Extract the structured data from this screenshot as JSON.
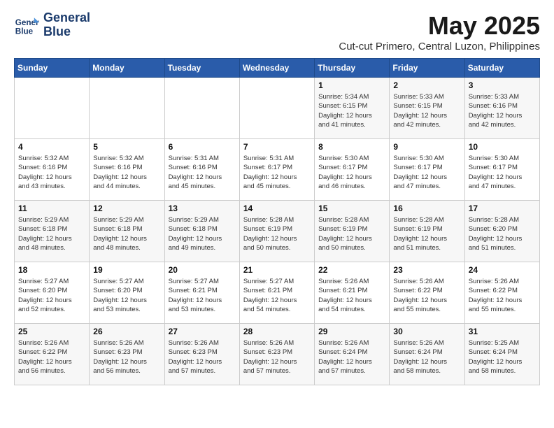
{
  "logo": {
    "line1": "General",
    "line2": "Blue"
  },
  "title": "May 2025",
  "subtitle": "Cut-cut Primero, Central Luzon, Philippines",
  "weekdays": [
    "Sunday",
    "Monday",
    "Tuesday",
    "Wednesday",
    "Thursday",
    "Friday",
    "Saturday"
  ],
  "weeks": [
    [
      {
        "day": "",
        "info": ""
      },
      {
        "day": "",
        "info": ""
      },
      {
        "day": "",
        "info": ""
      },
      {
        "day": "",
        "info": ""
      },
      {
        "day": "1",
        "info": "Sunrise: 5:34 AM\nSunset: 6:15 PM\nDaylight: 12 hours\nand 41 minutes."
      },
      {
        "day": "2",
        "info": "Sunrise: 5:33 AM\nSunset: 6:15 PM\nDaylight: 12 hours\nand 42 minutes."
      },
      {
        "day": "3",
        "info": "Sunrise: 5:33 AM\nSunset: 6:16 PM\nDaylight: 12 hours\nand 42 minutes."
      }
    ],
    [
      {
        "day": "4",
        "info": "Sunrise: 5:32 AM\nSunset: 6:16 PM\nDaylight: 12 hours\nand 43 minutes."
      },
      {
        "day": "5",
        "info": "Sunrise: 5:32 AM\nSunset: 6:16 PM\nDaylight: 12 hours\nand 44 minutes."
      },
      {
        "day": "6",
        "info": "Sunrise: 5:31 AM\nSunset: 6:16 PM\nDaylight: 12 hours\nand 45 minutes."
      },
      {
        "day": "7",
        "info": "Sunrise: 5:31 AM\nSunset: 6:17 PM\nDaylight: 12 hours\nand 45 minutes."
      },
      {
        "day": "8",
        "info": "Sunrise: 5:30 AM\nSunset: 6:17 PM\nDaylight: 12 hours\nand 46 minutes."
      },
      {
        "day": "9",
        "info": "Sunrise: 5:30 AM\nSunset: 6:17 PM\nDaylight: 12 hours\nand 47 minutes."
      },
      {
        "day": "10",
        "info": "Sunrise: 5:30 AM\nSunset: 6:17 PM\nDaylight: 12 hours\nand 47 minutes."
      }
    ],
    [
      {
        "day": "11",
        "info": "Sunrise: 5:29 AM\nSunset: 6:18 PM\nDaylight: 12 hours\nand 48 minutes."
      },
      {
        "day": "12",
        "info": "Sunrise: 5:29 AM\nSunset: 6:18 PM\nDaylight: 12 hours\nand 48 minutes."
      },
      {
        "day": "13",
        "info": "Sunrise: 5:29 AM\nSunset: 6:18 PM\nDaylight: 12 hours\nand 49 minutes."
      },
      {
        "day": "14",
        "info": "Sunrise: 5:28 AM\nSunset: 6:19 PM\nDaylight: 12 hours\nand 50 minutes."
      },
      {
        "day": "15",
        "info": "Sunrise: 5:28 AM\nSunset: 6:19 PM\nDaylight: 12 hours\nand 50 minutes."
      },
      {
        "day": "16",
        "info": "Sunrise: 5:28 AM\nSunset: 6:19 PM\nDaylight: 12 hours\nand 51 minutes."
      },
      {
        "day": "17",
        "info": "Sunrise: 5:28 AM\nSunset: 6:20 PM\nDaylight: 12 hours\nand 51 minutes."
      }
    ],
    [
      {
        "day": "18",
        "info": "Sunrise: 5:27 AM\nSunset: 6:20 PM\nDaylight: 12 hours\nand 52 minutes."
      },
      {
        "day": "19",
        "info": "Sunrise: 5:27 AM\nSunset: 6:20 PM\nDaylight: 12 hours\nand 53 minutes."
      },
      {
        "day": "20",
        "info": "Sunrise: 5:27 AM\nSunset: 6:21 PM\nDaylight: 12 hours\nand 53 minutes."
      },
      {
        "day": "21",
        "info": "Sunrise: 5:27 AM\nSunset: 6:21 PM\nDaylight: 12 hours\nand 54 minutes."
      },
      {
        "day": "22",
        "info": "Sunrise: 5:26 AM\nSunset: 6:21 PM\nDaylight: 12 hours\nand 54 minutes."
      },
      {
        "day": "23",
        "info": "Sunrise: 5:26 AM\nSunset: 6:22 PM\nDaylight: 12 hours\nand 55 minutes."
      },
      {
        "day": "24",
        "info": "Sunrise: 5:26 AM\nSunset: 6:22 PM\nDaylight: 12 hours\nand 55 minutes."
      }
    ],
    [
      {
        "day": "25",
        "info": "Sunrise: 5:26 AM\nSunset: 6:22 PM\nDaylight: 12 hours\nand 56 minutes."
      },
      {
        "day": "26",
        "info": "Sunrise: 5:26 AM\nSunset: 6:23 PM\nDaylight: 12 hours\nand 56 minutes."
      },
      {
        "day": "27",
        "info": "Sunrise: 5:26 AM\nSunset: 6:23 PM\nDaylight: 12 hours\nand 57 minutes."
      },
      {
        "day": "28",
        "info": "Sunrise: 5:26 AM\nSunset: 6:23 PM\nDaylight: 12 hours\nand 57 minutes."
      },
      {
        "day": "29",
        "info": "Sunrise: 5:26 AM\nSunset: 6:24 PM\nDaylight: 12 hours\nand 57 minutes."
      },
      {
        "day": "30",
        "info": "Sunrise: 5:26 AM\nSunset: 6:24 PM\nDaylight: 12 hours\nand 58 minutes."
      },
      {
        "day": "31",
        "info": "Sunrise: 5:25 AM\nSunset: 6:24 PM\nDaylight: 12 hours\nand 58 minutes."
      }
    ]
  ]
}
